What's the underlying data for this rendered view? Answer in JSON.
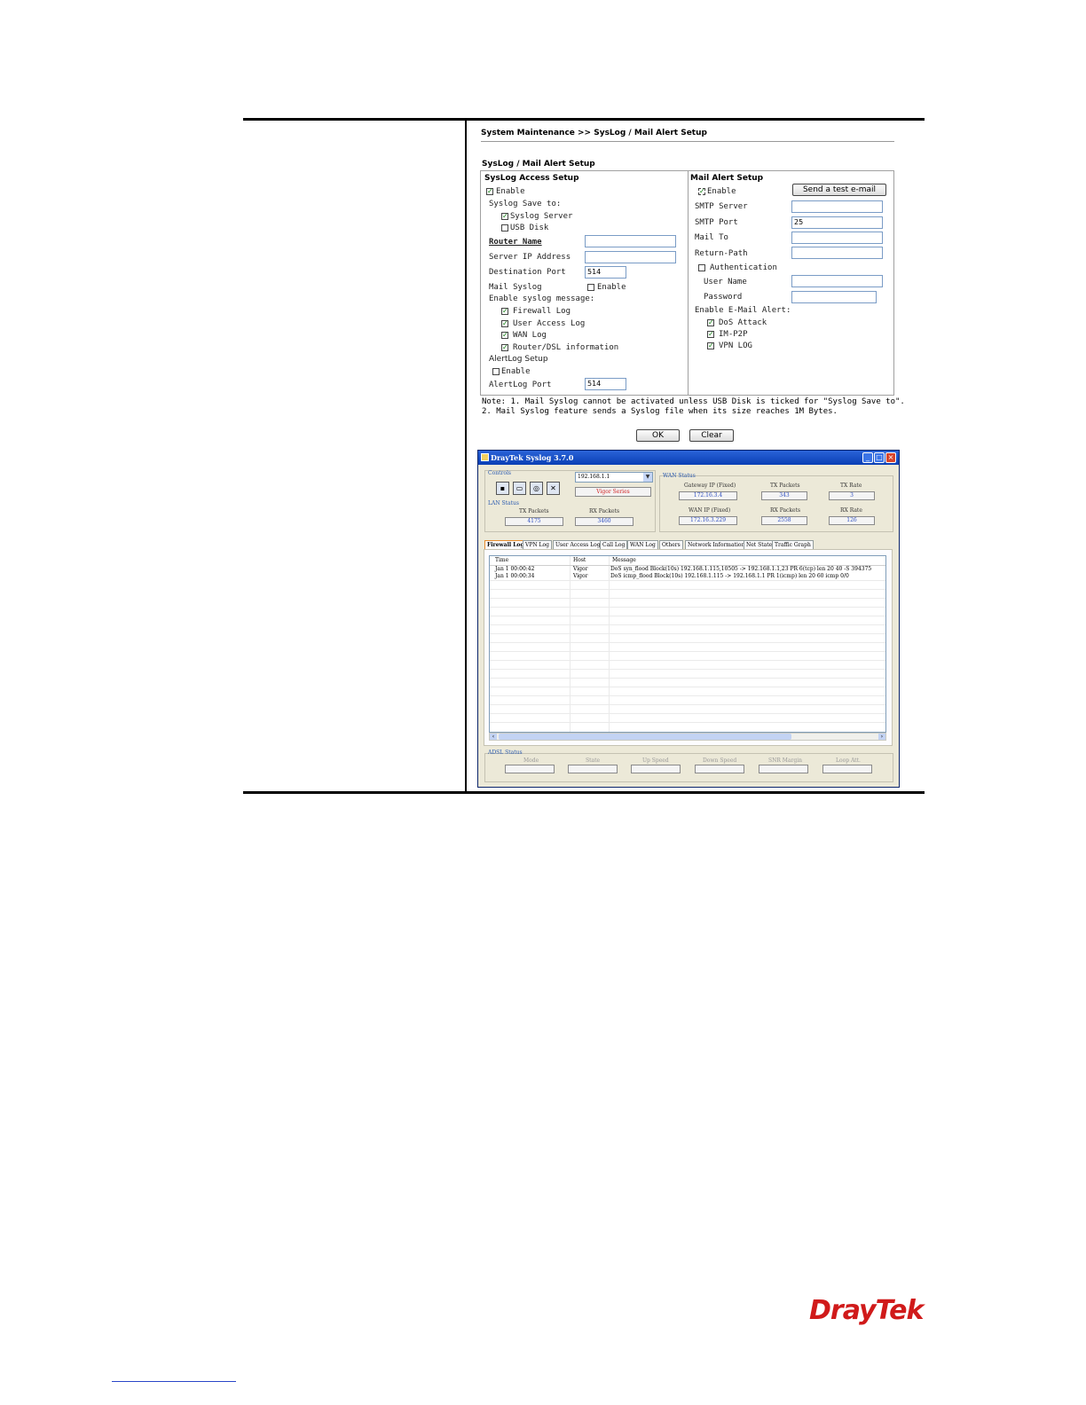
{
  "breadcrumb": "System Maintenance >> SysLog / Mail Alert Setup",
  "section_title": "SysLog / Mail Alert Setup",
  "syslog_access": {
    "title": "SysLog Access Setup",
    "enable_label": "Enable",
    "enable_checked": true,
    "save_to_label": "Syslog Save to:",
    "syslog_server_label": "Syslog Server",
    "syslog_server_checked": true,
    "usb_disk_label": "USB Disk",
    "usb_disk_checked": false,
    "router_name_label": "Router Name",
    "router_name_value": "",
    "server_ip_label": "Server IP Address",
    "server_ip_value": "",
    "dest_port_label": "Destination Port",
    "dest_port_value": "514",
    "mail_syslog_label": "Mail Syslog",
    "mail_syslog_enable_label": "Enable",
    "mail_syslog_checked": false,
    "enable_msg_label": "Enable syslog message:",
    "messages": [
      {
        "label": "Firewall Log",
        "checked": true
      },
      {
        "label": "User Access Log",
        "checked": true
      },
      {
        "label": "WAN Log",
        "checked": true
      },
      {
        "label": "Router/DSL information",
        "checked": true
      }
    ],
    "alertlog_title": "AlertLog Setup",
    "alertlog_enable_label": "Enable",
    "alertlog_enable_checked": false,
    "alertlog_port_label": "AlertLog Port",
    "alertlog_port_value": "514"
  },
  "mail_alert": {
    "title": "Mail Alert Setup",
    "enable_label": "Enable",
    "enable_checked": true,
    "test_button": "Send a test e-mail",
    "smtp_server_label": "SMTP Server",
    "smtp_server_value": "",
    "smtp_port_label": "SMTP Port",
    "smtp_port_value": "25",
    "mail_to_label": "Mail To",
    "mail_to_value": "",
    "return_path_label": "Return-Path",
    "return_path_value": "",
    "auth_label": "Authentication",
    "auth_checked": false,
    "user_name_label": "User Name",
    "password_label": "Password",
    "alert_label": "Enable E-Mail Alert:",
    "alerts": [
      {
        "label": "DoS Attack",
        "checked": true
      },
      {
        "label": "IM-P2P",
        "checked": true
      },
      {
        "label": "VPN LOG",
        "checked": true
      }
    ]
  },
  "notes": {
    "line1": "Note:  1. Mail Syslog cannot be activated unless USB Disk is ticked for \"Syslog Save to\".",
    "line2": "2. Mail Syslog feature sends a Syslog file when its size reaches 1M Bytes."
  },
  "buttons": {
    "ok": "OK",
    "clear": "Clear"
  },
  "syslog_app": {
    "title": "DrayTek Syslog 3.7.0",
    "controls_label": "Controls",
    "ip_select": "192.168.1.1",
    "device_name": "Vigor Series",
    "lan_status_label": "LAN Status",
    "lan_tx_label": "TX Packets",
    "lan_tx_value": "4175",
    "lan_rx_label": "RX Packets",
    "lan_rx_value": "3460",
    "wan_status_label": "WAN Status",
    "gateway_label": "Gateway IP (Fixed)",
    "gateway_value": "172.16.3.4",
    "wan_tx_label": "TX Packets",
    "wan_tx_value": "343",
    "tx_rate_label": "TX Rate",
    "tx_rate_value": "3",
    "wan_ip_label": "WAN IP (Fixed)",
    "wan_ip_value": "172.16.3.229",
    "wan_rx_label": "RX Packets",
    "wan_rx_value": "2558",
    "rx_rate_label": "RX Rate",
    "rx_rate_value": "126",
    "tabs": [
      "Firewall Log",
      "VPN Log",
      "User Access Log",
      "Call Log",
      "WAN Log",
      "Others",
      "Network Information",
      "Net State",
      "Traffic Graph"
    ],
    "columns": [
      "Time",
      "Host",
      "Message"
    ],
    "rows": [
      {
        "time": "Jan  1 00:00:42",
        "host": "Vigor",
        "message": "DoS syn_flood Block(10s) 192.168.1.115,10505 -> 192.168.1.1,23 PR 6(tcp) len 20 40 -S 394375"
      },
      {
        "time": "Jan  1 00:00:34",
        "host": "Vigor",
        "message": "DoS icmp_flood Block(10s) 192.168.1.115 -> 192.168.1.1 PR 1(icmp) len 20 60 icmp 0/0"
      }
    ],
    "adsl_status_label": "ADSL Status",
    "adsl_fields": [
      "Mode",
      "State",
      "Up Speed",
      "Down Speed",
      "SNR Margin",
      "Loop Att."
    ]
  },
  "logo": "DrayTek"
}
